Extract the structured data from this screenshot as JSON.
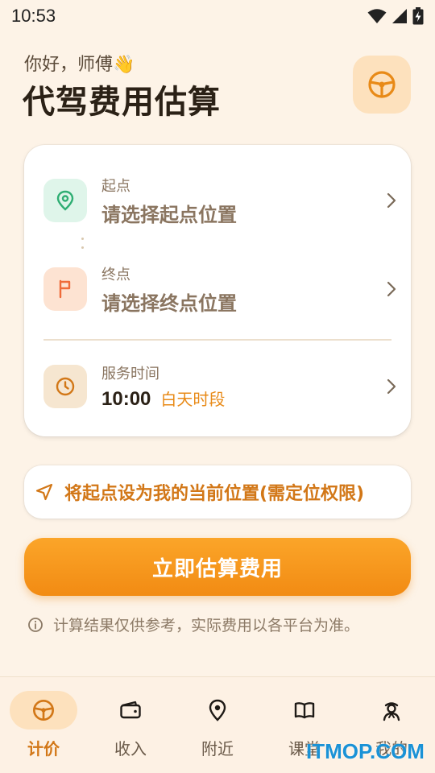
{
  "status_bar": {
    "time": "10:53",
    "icons": [
      "wifi-icon",
      "signal-icon",
      "battery-charging-icon"
    ]
  },
  "header": {
    "greeting": "你好，师傅",
    "greeting_emoji": "👋",
    "title": "代驾费用估算",
    "action_icon": "steering-wheel-icon"
  },
  "route_card": {
    "start": {
      "label": "起点",
      "value": "请选择起点位置",
      "icon": "location-pin-icon",
      "icon_color": "#2fae73",
      "icon_bg": "#dff5ea"
    },
    "end": {
      "label": "终点",
      "value": "请选择终点位置",
      "icon": "flag-icon",
      "icon_color": "#ef6b3a",
      "icon_bg": "#fde3d2"
    },
    "service_time": {
      "label": "服务时间",
      "value": "10:00",
      "period": "白天时段",
      "icon": "clock-icon",
      "icon_color": "#d27717",
      "icon_bg": "#f6e6d0"
    }
  },
  "location_button": {
    "label": "将起点设为我的当前位置(需定位权限)",
    "icon": "navigation-arrow-icon"
  },
  "estimate_button": {
    "label": "立即估算费用"
  },
  "disclaimer": {
    "text": "计算结果仅供参考，实际费用以各平台为准。",
    "icon": "info-icon"
  },
  "bottom_nav": {
    "items": [
      {
        "label": "计价",
        "icon": "steering-wheel-icon",
        "active": true
      },
      {
        "label": "收入",
        "icon": "wallet-icon",
        "active": false
      },
      {
        "label": "附近",
        "icon": "location-pin-icon",
        "active": false
      },
      {
        "label": "课堂",
        "icon": "book-icon",
        "active": false
      },
      {
        "label": "我的",
        "icon": "driver-icon",
        "active": false
      }
    ]
  },
  "watermark": "ITMOP.COM",
  "colors": {
    "accent": "#f28b13",
    "accent_text": "#d27717",
    "background": "#fdf3e7"
  }
}
